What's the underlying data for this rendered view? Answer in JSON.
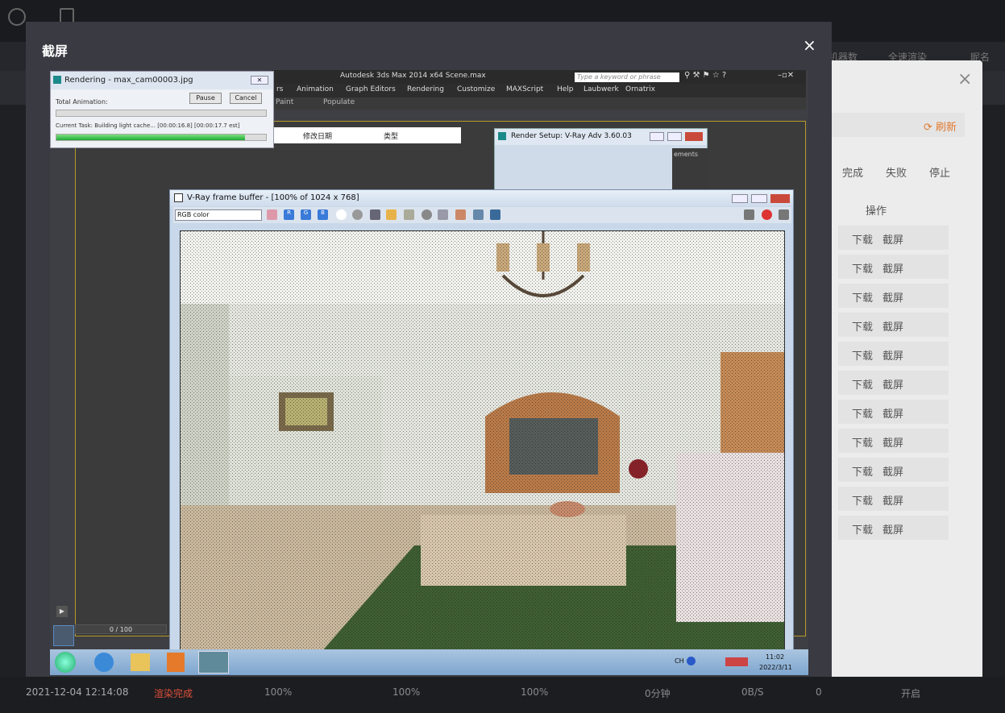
{
  "modal": {
    "title": "截屏",
    "close": "×"
  },
  "background": {
    "header_right": [
      "机器数",
      "全速渲染",
      "昵名"
    ],
    "refresh": "刷新",
    "dialog_close": "×",
    "status_headers": [
      "完成",
      "失败",
      "停止"
    ],
    "op_header": "操作",
    "op_rows": [
      {
        "download": "下载",
        "screenshot": "截屏"
      },
      {
        "download": "下载",
        "screenshot": "截屏"
      },
      {
        "download": "下载",
        "screenshot": "截屏"
      },
      {
        "download": "下载",
        "screenshot": "截屏"
      },
      {
        "download": "下载",
        "screenshot": "截屏"
      },
      {
        "download": "下载",
        "screenshot": "截屏"
      },
      {
        "download": "下载",
        "screenshot": "截屏"
      },
      {
        "download": "下载",
        "screenshot": "截屏"
      },
      {
        "download": "下载",
        "screenshot": "截屏"
      },
      {
        "download": "下载",
        "screenshot": "截屏"
      },
      {
        "download": "下载",
        "screenshot": "截屏"
      }
    ],
    "bottom_row": {
      "date": "2021-12-04 12:14:08",
      "status": "渲染完成",
      "p1": "100%",
      "p2": "100%",
      "p3": "100%",
      "time": "0分钟",
      "speed": "0B/S",
      "count": "0",
      "action": "开启"
    }
  },
  "max": {
    "title": "Autodesk 3ds Max  2014 x64     Scene.max",
    "search_placeholder": "Type a keyword or phrase",
    "menu": [
      "rs",
      "Animation",
      "Graph Editors",
      "Rendering",
      "Customize",
      "MAXScript",
      "Help",
      "Laubwerk",
      "Ornatrix"
    ],
    "tool": [
      "Paint",
      "Populate"
    ],
    "file_cols": [
      "修改日期",
      "类型"
    ],
    "render_setup_title": "Render Setup: V-Ray Adv 3.60.03",
    "render_setup_tab": "ements",
    "timeline": "0 / 100"
  },
  "rendering": {
    "title": "Rendering - max_cam00003.jpg",
    "total_label": "Total Animation:",
    "pause": "Pause",
    "cancel": "Cancel",
    "current_task": "Current Task:   Building light cache... [00:00:16.8] [00:00:17.7 est]",
    "task_progress": 0.9
  },
  "vfb": {
    "title": "V-Ray frame buffer - [100% of 1024 x 768]",
    "channel": "RGB color",
    "rgb": [
      "R",
      "G",
      "B"
    ]
  },
  "taskbar": {
    "lang": "CH",
    "time": "11:02",
    "date": "2022/3/11"
  },
  "colors": {
    "accent": "#e07a2f",
    "status_done": "#e0503a"
  }
}
